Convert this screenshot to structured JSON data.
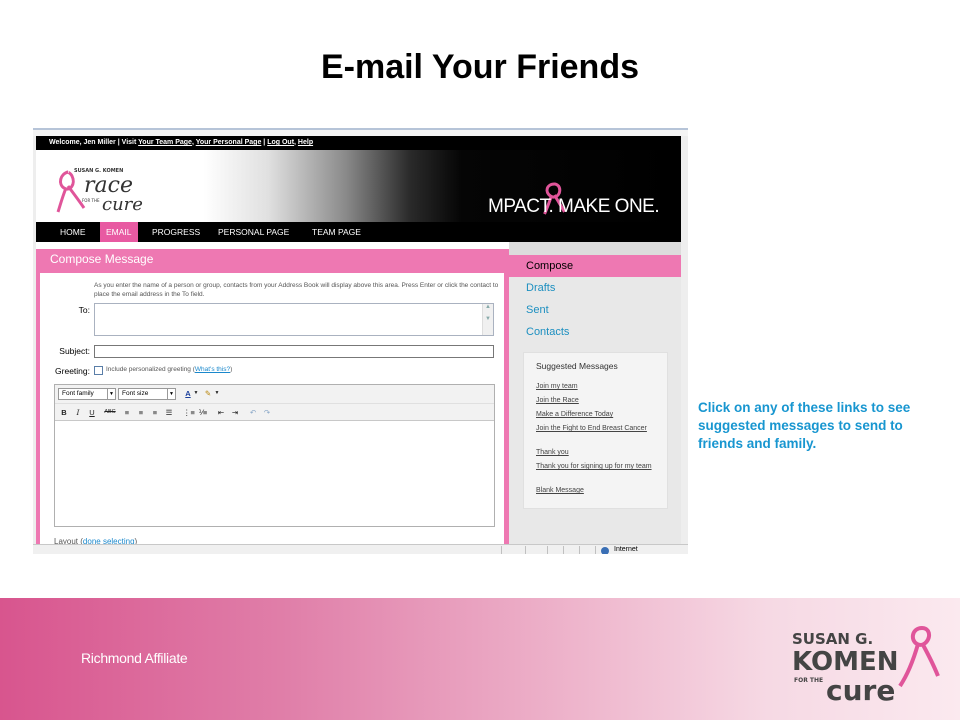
{
  "slide": {
    "title": "E-mail Your Friends",
    "callout": "Click on any of these links to see suggested messages to send to friends and family.",
    "footer_text": "Richmond Affiliate"
  },
  "site": {
    "welcome": "Welcome, Jen Miller",
    "visit": "Visit",
    "top_links": [
      "Your Team Page",
      "Your Personal Page",
      "Log Out",
      "Help"
    ],
    "logo": {
      "line1": "SUSAN G. KOMEN",
      "race": "race",
      "for_the": "FOR THE",
      "cure": "cure"
    },
    "impact_text": "MPACT. MAKE ONE.",
    "nav": [
      "HOME",
      "EMAIL",
      "PROGRESS",
      "PERSONAL PAGE",
      "TEAM PAGE"
    ],
    "compose": {
      "title": "Compose Message",
      "help_text": "As you enter the name of a person or group, contacts from your Address Book will display above this area. Press Enter or click the contact to place the email address in the To field.",
      "to_label": "To:",
      "subject_label": "Subject:",
      "greeting_label": "Greeting:",
      "greeting_option": "Include personalized greeting",
      "whats_this": "What's this?",
      "font_family": "Font family",
      "font_size": "Font size",
      "layout_label": "Layout",
      "done_selecting": "done selecting"
    },
    "sidebar": {
      "items": [
        "Compose",
        "Drafts",
        "Sent",
        "Contacts"
      ],
      "suggested_title": "Suggested Messages",
      "suggested": [
        "Join my team",
        "Join the Race",
        "Make a Difference Today",
        "Join the Fight to End Breast Cancer",
        "Thank you",
        "Thank you for signing up for my team",
        "Blank Message"
      ]
    },
    "status": {
      "zone": "Internet"
    }
  },
  "footer_logo": {
    "line1": "SUSAN G.",
    "line2": "KOMEN",
    "for_the": "FOR THE",
    "cure": "cure"
  },
  "colors": {
    "pink": "#ee78b2",
    "link_blue": "#1896d0"
  }
}
